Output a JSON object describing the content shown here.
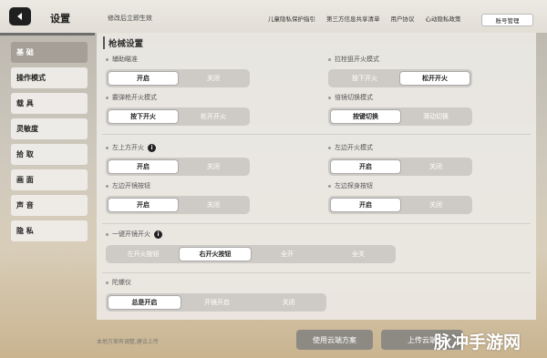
{
  "header": {
    "title": "设置",
    "hint": "修改后立即生效",
    "links": [
      "儿童隐私保护指引",
      "第三方信息共享清单",
      "用户协议",
      "心动隐私政策"
    ],
    "account_button": "账号管理"
  },
  "sidebar": {
    "items": [
      {
        "label": "基 础",
        "active": true
      },
      {
        "label": "操作模式",
        "active": false
      },
      {
        "label": "载 具",
        "active": false
      },
      {
        "label": "灵敏度",
        "active": false
      },
      {
        "label": "拾 取",
        "active": false
      },
      {
        "label": "画 面",
        "active": false
      },
      {
        "label": "声 音",
        "active": false
      },
      {
        "label": "隐 私",
        "active": false
      }
    ]
  },
  "panel": {
    "title": "枪械设置",
    "settings": {
      "aim_assist": {
        "label": "辅助瞄准",
        "options": [
          "开启",
          "关闭"
        ],
        "selected": "开启"
      },
      "bolt_fire": {
        "label": "拉栓狙开火模式",
        "options": [
          "按下开火",
          "松开开火"
        ],
        "selected": "松开开火"
      },
      "scatter_fire": {
        "label": "霰弹枪开火模式",
        "options": [
          "按下开火",
          "松开开火"
        ],
        "selected": "按下开火"
      },
      "scope_switch": {
        "label": "倍镜切换模式",
        "options": [
          "按键切换",
          "滑动切换"
        ],
        "selected": "按键切换"
      },
      "upper_left_fire": {
        "label": "左上方开火",
        "options": [
          "开启",
          "关闭"
        ],
        "selected": "开启"
      },
      "left_fire_mode": {
        "label": "左边开火模式",
        "options": [
          "开启",
          "关闭"
        ],
        "selected": "开启"
      },
      "left_scope_btn": {
        "label": "左边开镜按钮",
        "options": [
          "开启",
          "关闭"
        ],
        "selected": "开启"
      },
      "left_peek_btn": {
        "label": "左边探身按钮",
        "options": [
          "开启",
          "关闭"
        ],
        "selected": "开启"
      },
      "one_key_scope": {
        "label": "一键开镜开火",
        "options": [
          "左开火按钮",
          "右开火按钮",
          "全开",
          "全关"
        ],
        "selected": "右开火按钮"
      },
      "gyro": {
        "label": "陀螺仪",
        "options": [
          "总是开启",
          "开镜开启",
          "关闭"
        ],
        "selected": "总是开启"
      }
    }
  },
  "footer": {
    "note": "本地方案有调整,建议上传",
    "cloud_scheme_button": "使用云端方案",
    "upload_button": "上传云端"
  },
  "watermark": "脉冲手游网",
  "colors": {
    "accent_dark": "#1f1f1f",
    "sidebar_active": "#a59f97",
    "segment_bg": "#cecbc6"
  }
}
